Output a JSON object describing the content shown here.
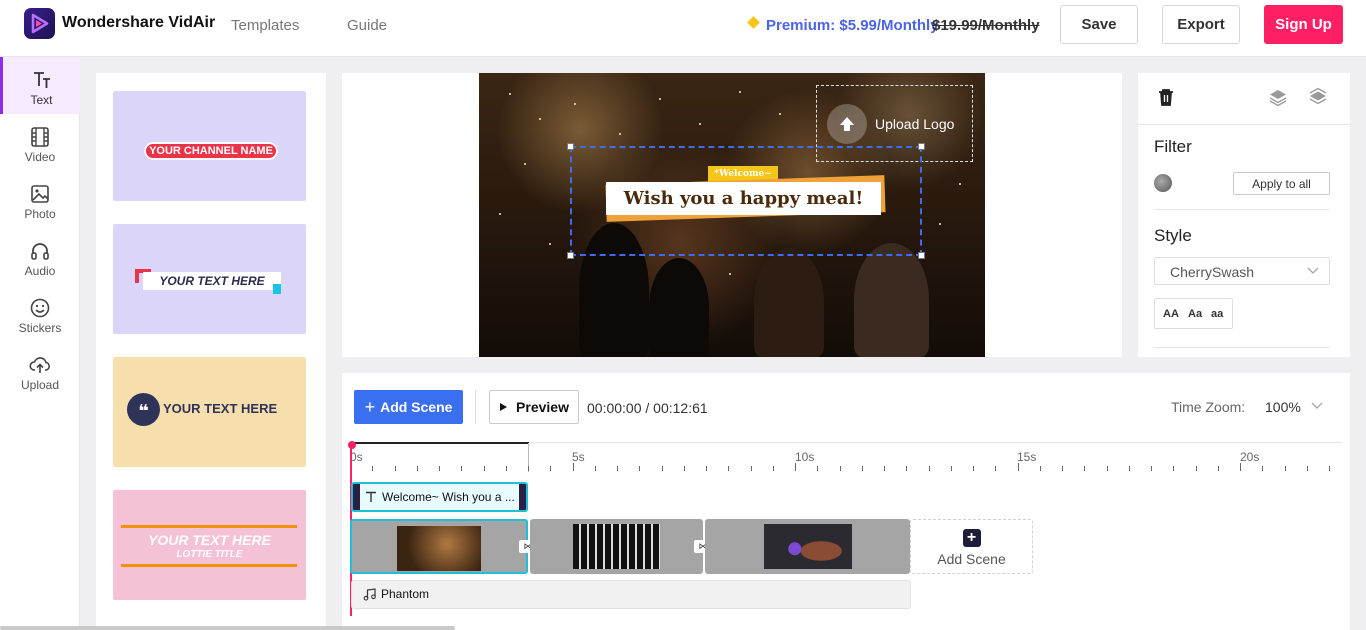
{
  "header": {
    "app_name": "Wondershare VidAir",
    "nav": [
      "Templates",
      "Guide"
    ],
    "premium_text": "Premium: $5.99/Monthly",
    "old_price": "$19.99/Monthly",
    "save_label": "Save",
    "export_label": "Export",
    "signup_label": "Sign Up"
  },
  "rail": {
    "items": [
      {
        "label": "Text",
        "icon": "text-icon"
      },
      {
        "label": "Video",
        "icon": "film-icon"
      },
      {
        "label": "Photo",
        "icon": "image-icon"
      },
      {
        "label": "Audio",
        "icon": "headphones-icon"
      },
      {
        "label": "Stickers",
        "icon": "smiley-icon"
      },
      {
        "label": "Upload",
        "icon": "cloud-upload-icon"
      }
    ]
  },
  "templates": [
    {
      "text": "YOUR CHANNEL NAME",
      "bg": "#dcd5fa"
    },
    {
      "text": "YOUR TEXT HERE",
      "bg": "#dcd5fa"
    },
    {
      "text": "YOUR TEXT HERE",
      "bg": "#f7dfad"
    },
    {
      "text": "YOUR TEXT HERE",
      "subtext": "LOTTIE TITLE",
      "bg": "#f4c1d6"
    }
  ],
  "canvas": {
    "upload_logo": "Upload Logo",
    "welcome_tag": "*Welcome~",
    "headline": "Wish you a happy meal!"
  },
  "props": {
    "filter_title": "Filter",
    "apply_all": "Apply to all",
    "style_title": "Style",
    "font_name": "CherrySwash",
    "case_options": [
      "AA",
      "Aa",
      "aa"
    ]
  },
  "timeline": {
    "add_scene": "Add Scene",
    "preview": "Preview",
    "time": "00:00:00 / 00:12:61",
    "zoom_label": "Time Zoom:",
    "zoom_value": "100%",
    "ruler_labels": [
      "0s",
      "5s",
      "10s",
      "15s",
      "20s"
    ],
    "text_clip": "Welcome~ Wish you a ...",
    "add_scene_tile": "Add Scene",
    "audio_clip": "Phantom"
  },
  "colors": {
    "brand": "#ff1f64",
    "accent_blue": "#3a6ff0",
    "premium_blue": "#4a63e7",
    "selection": "#1ec0d8"
  }
}
